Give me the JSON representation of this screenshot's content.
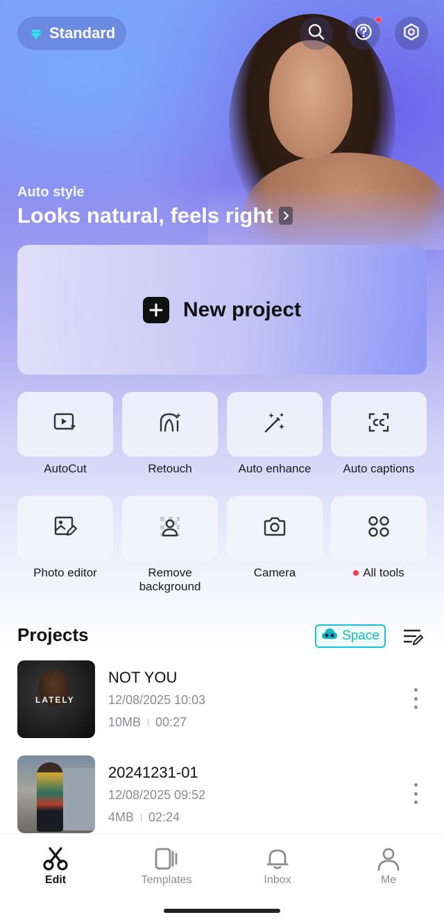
{
  "header": {
    "plan_label": "Standard",
    "icons": [
      "search-icon",
      "help-icon",
      "settings-icon"
    ]
  },
  "hero": {
    "kicker": "Auto style",
    "title": "Looks natural, feels right"
  },
  "new_project": {
    "label": "New project"
  },
  "tools": [
    {
      "label": "AutoCut",
      "icon": "autocut-icon"
    },
    {
      "label": "Retouch",
      "icon": "retouch-icon"
    },
    {
      "label": "Auto enhance",
      "icon": "magic-wand-icon"
    },
    {
      "label": "Auto captions",
      "icon": "captions-icon"
    },
    {
      "label": "Photo editor",
      "icon": "photo-editor-icon"
    },
    {
      "label": "Remove background",
      "icon": "remove-background-icon"
    },
    {
      "label": "Camera",
      "icon": "camera-icon"
    },
    {
      "label": "All tools",
      "icon": "grid-icon"
    }
  ],
  "projects": {
    "title": "Projects",
    "space_label": "Space",
    "items": [
      {
        "name": "NOT YOU",
        "date": "12/08/2025 10:03",
        "size": "10MB",
        "duration": "00:27",
        "thumb_text": "LATELY"
      },
      {
        "name": "20241231-01",
        "date": "12/08/2025 09:52",
        "size": "4MB",
        "duration": "02:24"
      }
    ]
  },
  "tabs": [
    {
      "label": "Edit",
      "icon": "scissors-icon"
    },
    {
      "label": "Templates",
      "icon": "templates-icon"
    },
    {
      "label": "Inbox",
      "icon": "bell-icon"
    },
    {
      "label": "Me",
      "icon": "person-icon"
    }
  ],
  "colors": {
    "accent_cyan": "#19c2d6",
    "notification_red": "#ff3b4e",
    "hero_purple": "#7f7cf0"
  }
}
